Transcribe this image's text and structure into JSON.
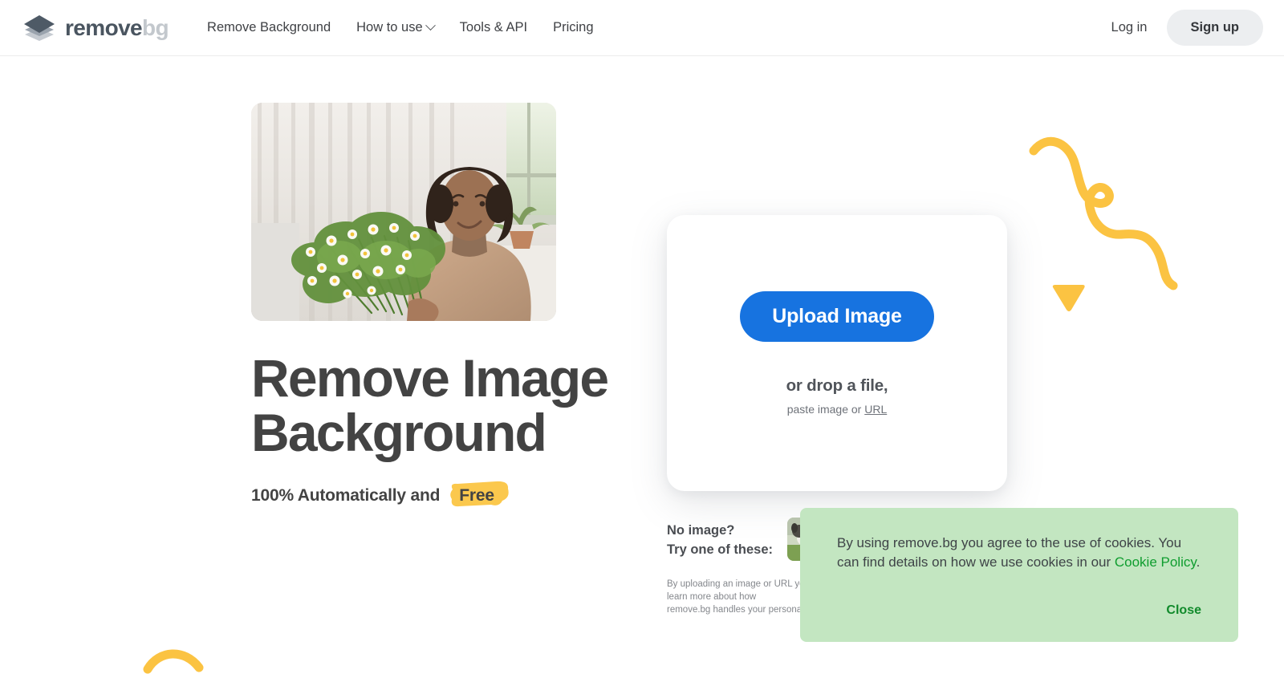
{
  "header": {
    "logo": {
      "icon": "layers-diamond-icon",
      "name_dark": "remove",
      "name_light": "bg"
    },
    "nav": [
      {
        "label": "Remove Background",
        "has_chevron": false
      },
      {
        "label": "How to use",
        "has_chevron": true
      },
      {
        "label": "Tools & API",
        "has_chevron": false
      },
      {
        "label": "Pricing",
        "has_chevron": false
      }
    ],
    "login_label": "Log in",
    "signup_label": "Sign up"
  },
  "hero": {
    "photo_alt": "Smiling woman with curly hair holding a bouquet of white daisies in a bright room",
    "title": "Remove Image\nBackground",
    "subtitle_prefix": "100% Automatically and",
    "subtitle_highlight": "Free",
    "highlight_color": "#fcc94a"
  },
  "upload": {
    "button_label": "Upload Image",
    "drop_label": "or drop a file,",
    "paste_prefix": "paste image or ",
    "paste_link": "URL",
    "button_color": "#1773e0"
  },
  "samples": {
    "caption": "No image?\nTry one of these:",
    "thumbnails": [
      {
        "alt": "dog running on grass"
      }
    ],
    "legal": "By uploading an image or URL you agree to our Terms of Service. To learn more about how\nremove.bg handles your personal data, check our Privacy Policy."
  },
  "cookie_banner": {
    "text_before_link": "By using remove.bg you agree to the use of cookies. You can find details on how we use cookies in our ",
    "link_label": "Cookie Policy",
    "text_after_link": ".",
    "close_label": "Close",
    "background_color": "#c3e6c1",
    "link_color": "#0f9d2f"
  },
  "decorations": {
    "squiggle_color": "#fbc342",
    "triangle_color": "#fbc342",
    "arc_color": "#fbc342"
  }
}
